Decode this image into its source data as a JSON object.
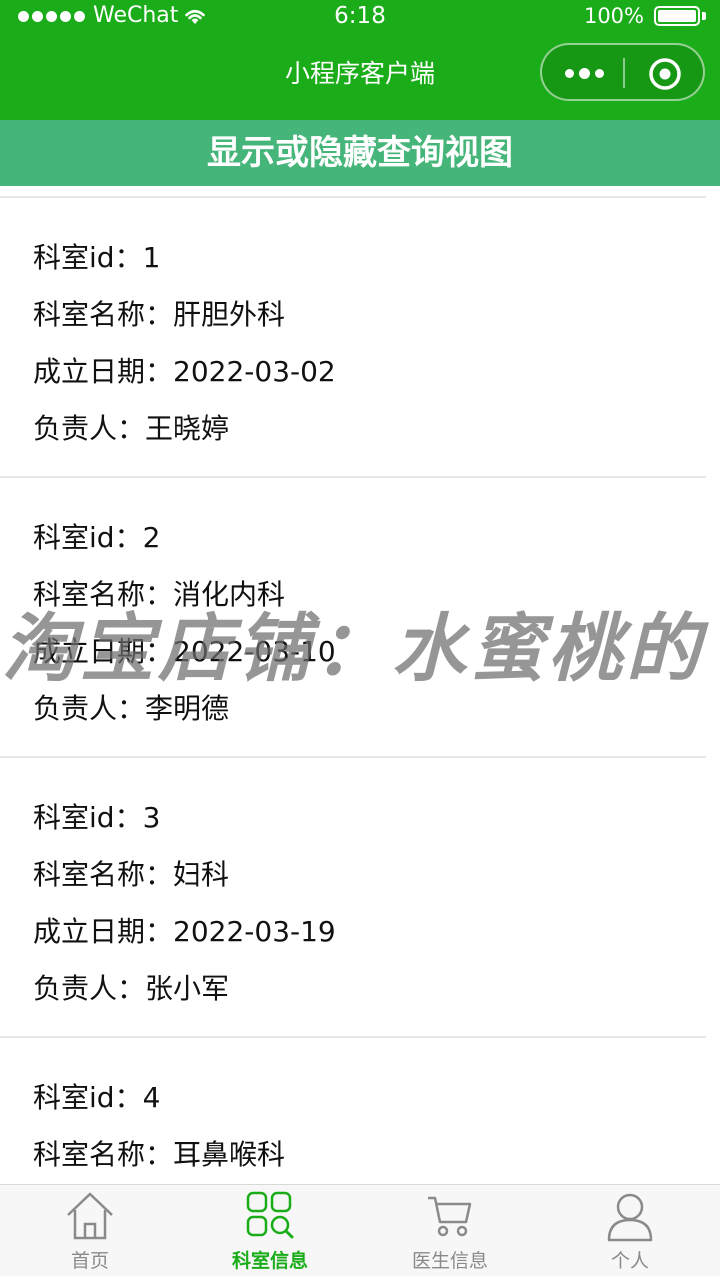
{
  "status_bar": {
    "carrier": "WeChat",
    "time": "6:18",
    "battery_percent": "100%",
    "battery_level": 1.0
  },
  "nav": {
    "title": "小程序客户端"
  },
  "toggle_button": {
    "label": "显示或隐藏查询视图"
  },
  "departments": [
    {
      "id": {
        "label": "科室id：",
        "value": "1"
      },
      "name": {
        "label": "科室名称：",
        "value": "肝胆外科"
      },
      "date": {
        "label": "成立日期：",
        "value": "2022-03-02"
      },
      "head": {
        "label": "负责人：",
        "value": "王晓婷"
      }
    },
    {
      "id": {
        "label": "科室id：",
        "value": "2"
      },
      "name": {
        "label": "科室名称：",
        "value": "消化内科"
      },
      "date": {
        "label": "成立日期：",
        "value": "2022-03-10"
      },
      "head": {
        "label": "负责人：",
        "value": "李明德"
      }
    },
    {
      "id": {
        "label": "科室id：",
        "value": "3"
      },
      "name": {
        "label": "科室名称：",
        "value": "妇科"
      },
      "date": {
        "label": "成立日期：",
        "value": "2022-03-19"
      },
      "head": {
        "label": "负责人：",
        "value": "张小军"
      }
    },
    {
      "id": {
        "label": "科室id：",
        "value": "4"
      },
      "name": {
        "label": "科室名称：",
        "value": "耳鼻喉科"
      }
    }
  ],
  "watermark": {
    "text": "淘宝店铺：水蜜桃的"
  },
  "tabs": [
    {
      "label": "首页",
      "icon": "home-icon",
      "active": false
    },
    {
      "label": "科室信息",
      "icon": "department-search-icon",
      "active": true
    },
    {
      "label": "医生信息",
      "icon": "cart-icon",
      "active": false
    },
    {
      "label": "个人",
      "icon": "person-icon",
      "active": false
    }
  ],
  "colors": {
    "nav_green": "#1aad19",
    "toggle_green": "#46b579",
    "tab_active": "#1aad19",
    "tab_inactive": "#8a8a8a"
  }
}
